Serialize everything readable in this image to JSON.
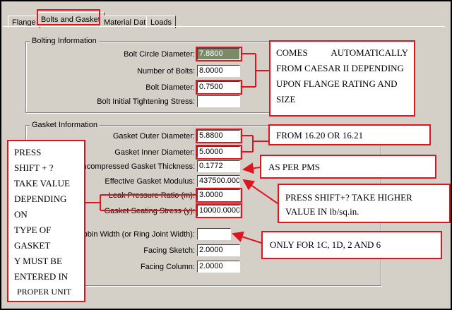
{
  "tabs": [
    "Flange",
    "Bolts and Gasket",
    "Material Data",
    "Loads"
  ],
  "bolting": {
    "title": "Bolting Information",
    "fields": [
      {
        "label": "Bolt Circle Diameter:",
        "value": "7.8800"
      },
      {
        "label": "Number of Bolts:",
        "value": "8.0000"
      },
      {
        "label": "Bolt Diameter:",
        "value": "0.7500"
      },
      {
        "label": "Bolt Initial Tightening Stress:",
        "value": ""
      }
    ]
  },
  "gasket": {
    "title": "Gasket Information",
    "fields": [
      {
        "label": "Gasket Outer Diameter:",
        "value": "5.8800"
      },
      {
        "label": "Gasket Inner Diameter:",
        "value": "5.0000"
      },
      {
        "label": "Uncompressed Gasket Thickness:",
        "value": "0.1772"
      },
      {
        "label": "Effective Gasket Modulus:",
        "value": "437500.0000"
      },
      {
        "label": "Leak Pressure Ratio (m):",
        "value": "3.0000"
      },
      {
        "label": "Gasket Seating Stress (y):",
        "value": "10000.0000"
      },
      {
        "label": "Nubbin Width (or Ring Joint Width):",
        "value": ""
      },
      {
        "label": "Facing Sketch:",
        "value": "2.0000"
      },
      {
        "label": "Facing Column:",
        "value": "2.0000"
      }
    ]
  },
  "annotations": {
    "caesar": [
      "COMES",
      "AUTOMATICALLY",
      "FROM CAESAR II DEPENDING",
      "UPON  FLANGE  RATING  AND",
      "SIZE"
    ],
    "from": "FROM 16.20 OR 16.21",
    "pms": "AS PER PMS",
    "shift_right": [
      "PRESS    SHIFT+?    TAKE    HIGHER",
      "VALUE IN lb/sq.in."
    ],
    "nubbin": "ONLY FOR 1C, 1D, 2 AND 6",
    "left": [
      "PRESS",
      "SHIFT + ?",
      "TAKE VALUE",
      "DEPENDING",
      "ON",
      "TYPE OF",
      "GASKET",
      "Y MUST BE",
      "ENTERED IN",
      "PROPER UNIT"
    ]
  },
  "colors": {
    "annotation_red": "#e0141e",
    "dialog_bg": "#d4d0c8",
    "selected_field": "#7a8a66"
  }
}
